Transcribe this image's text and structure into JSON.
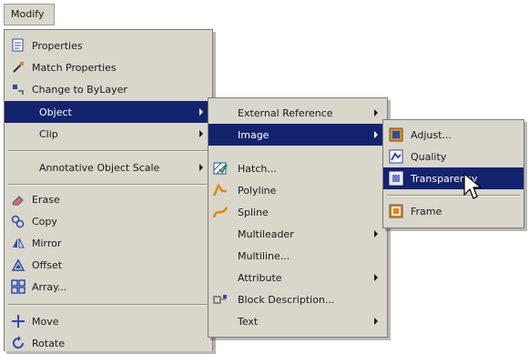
{
  "menubar": {
    "title": "Modify"
  },
  "modify_menu": {
    "items": [
      {
        "label": "Properties",
        "icon": "properties-icon"
      },
      {
        "label": "Match Properties",
        "icon": "match-properties-icon"
      },
      {
        "label": "Change to ByLayer",
        "icon": "change-to-bylayer-icon"
      },
      {
        "label": "Object",
        "submenu": true,
        "highlighted": true
      },
      {
        "label": "Clip",
        "submenu": true
      },
      {
        "label": "Annotative Object Scale",
        "submenu": true
      },
      {
        "label": "Erase",
        "icon": "eraser-icon"
      },
      {
        "label": "Copy",
        "icon": "copy-icon"
      },
      {
        "label": "Mirror",
        "icon": "mirror-icon"
      },
      {
        "label": "Offset",
        "icon": "offset-icon"
      },
      {
        "label": "Array...",
        "icon": "array-icon"
      },
      {
        "label": "Move",
        "icon": "move-icon"
      },
      {
        "label": "Rotate",
        "icon": "rotate-icon"
      }
    ]
  },
  "object_menu": {
    "items": [
      {
        "label": "External Reference",
        "submenu": true
      },
      {
        "label": "Image",
        "submenu": true,
        "highlighted": true
      },
      {
        "label": "Hatch...",
        "icon": "hatch-icon"
      },
      {
        "label": "Polyline",
        "icon": "polyline-icon"
      },
      {
        "label": "Spline",
        "icon": "spline-icon"
      },
      {
        "label": "Multileader",
        "submenu": true
      },
      {
        "label": "Multiline..."
      },
      {
        "label": "Attribute",
        "submenu": true
      },
      {
        "label": "Block Description...",
        "icon": "block-description-icon"
      },
      {
        "label": "Text",
        "submenu": true
      }
    ]
  },
  "image_menu": {
    "items": [
      {
        "label": "Adjust...",
        "icon": "image-adjust-icon"
      },
      {
        "label": "Quality",
        "icon": "image-quality-icon"
      },
      {
        "label": "Transparency",
        "icon": "image-transparency-icon",
        "highlighted": true
      },
      {
        "label": "Frame",
        "icon": "image-frame-icon"
      }
    ]
  },
  "colors": {
    "menu_background": "#d9d6cc",
    "highlight": "#14236e",
    "highlight_text": "#ffffff",
    "icon_blue": "#2e4aa8",
    "icon_orange": "#d98a18"
  }
}
